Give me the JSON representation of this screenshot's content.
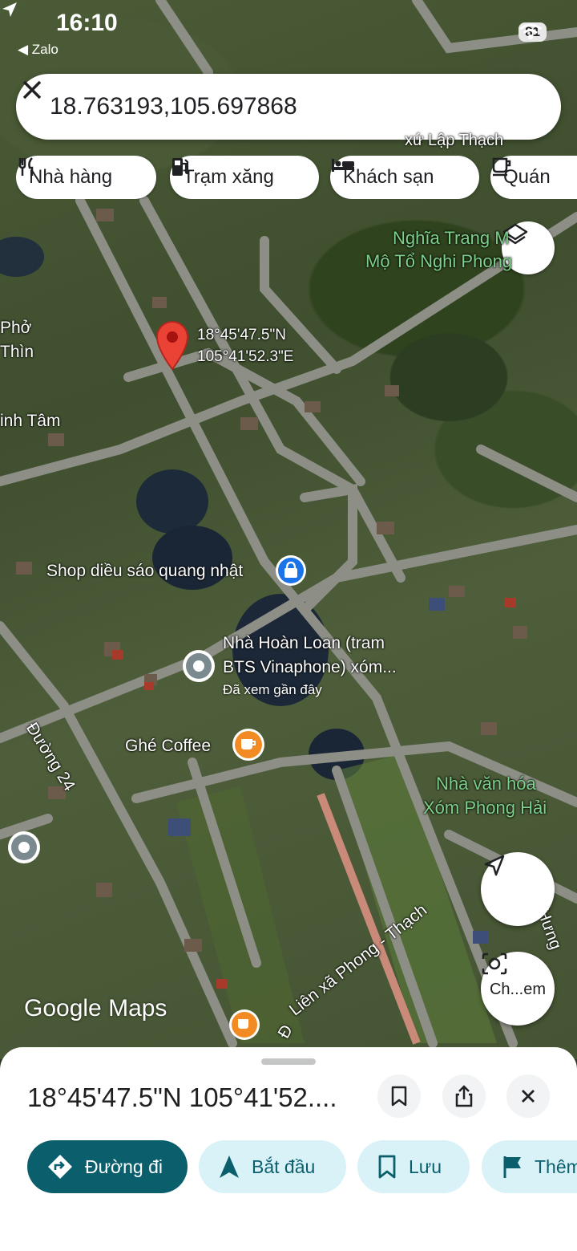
{
  "status_bar": {
    "time": "16:10",
    "back_app": "Zalo",
    "battery": "81"
  },
  "search": {
    "value": "18.763193,105.697868"
  },
  "chips": [
    {
      "label": "Nhà hàng",
      "icon": "restaurant-icon"
    },
    {
      "label": "Trạm xăng",
      "icon": "gas-station-icon"
    },
    {
      "label": "Khách sạn",
      "icon": "hotel-icon"
    },
    {
      "label": "Quán",
      "icon": "cafe-icon"
    }
  ],
  "map": {
    "labels": {
      "xu_lap_thach": "xứ Lập Thạch",
      "nghia_trang_1": "Nghĩa Trang M",
      "nghia_trang_2": "Mộ Tổ Nghi Phong",
      "pho": "Phở",
      "thin": "Thìn",
      "tam": "inh Tâm",
      "duong24": "Đường 24",
      "lien_xa": "Liên xã Phong - Thạch",
      "nvh_1": "Nhà văn hóa",
      "nvh_2": "Xóm Phong Hải",
      "hung": "Hưng",
      "d_partial": "Đ"
    },
    "pin": {
      "lat": "18°45'47.5\"N",
      "lng": "105°41'52.3\"E"
    },
    "pois": {
      "shop": "Shop diều sáo quang nhật",
      "nha_hoan_1": "Nhà Hoàn Loan (tram",
      "nha_hoan_2": "BTS Vinaphone) xóm...",
      "nha_hoan_sub": "Đã xem gần đây",
      "coffee": "Ghé Coffee"
    },
    "logo": "Google Maps",
    "lens_label": "Ch...em"
  },
  "sheet": {
    "title": "18°45'47.5\"N 105°41'52....",
    "actions": [
      {
        "label": "Đường đi",
        "icon": "directions-icon"
      },
      {
        "label": "Bắt đầu",
        "icon": "navigation-icon"
      },
      {
        "label": "Lưu",
        "icon": "bookmark-icon"
      },
      {
        "label": "Thêm",
        "icon": "flag-icon"
      }
    ]
  },
  "colors": {
    "accent": "#0b5f6d",
    "secondary_bg": "#d9f2f7",
    "pin": "#ea4335",
    "poi_orange": "#f28b24"
  }
}
